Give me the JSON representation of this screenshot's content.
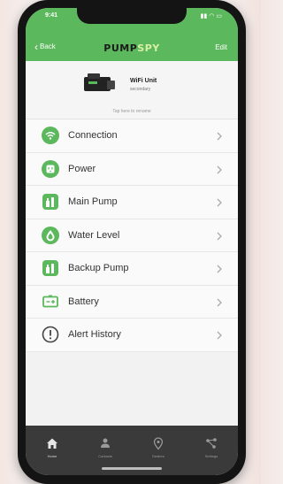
{
  "status_bar": {
    "time": "9:41",
    "icons": [
      "signal-icon",
      "wifi-icon",
      "battery-icon"
    ]
  },
  "header": {
    "back_label": "Back",
    "logo_part1": "PUMP",
    "logo_part2": "SPY",
    "edit_label": "Edit",
    "bg_color": "#5cb85c"
  },
  "device": {
    "name": "WiFi Unit",
    "subtitle": "secondary",
    "link": "Tap here to rename"
  },
  "menu": {
    "icon_color": "#5cb85c",
    "items": [
      {
        "label": "Connection",
        "icon": "wifi-icon"
      },
      {
        "label": "Power",
        "icon": "outlet-icon"
      },
      {
        "label": "Main Pump",
        "icon": "pump-icon"
      },
      {
        "label": "Water Level",
        "icon": "water-drop-icon"
      },
      {
        "label": "Backup Pump",
        "icon": "pump-icon"
      },
      {
        "label": "Battery",
        "icon": "battery-icon"
      },
      {
        "label": "Alert History",
        "icon": "alert-icon"
      }
    ]
  },
  "tabbar": {
    "tabs": [
      {
        "label": "Home",
        "icon": "home-icon",
        "active": true
      },
      {
        "label": "Contacts",
        "icon": "contacts-icon",
        "active": false
      },
      {
        "label": "Dealers",
        "icon": "location-icon",
        "active": false
      },
      {
        "label": "Settings",
        "icon": "share-icon",
        "active": false
      }
    ]
  }
}
